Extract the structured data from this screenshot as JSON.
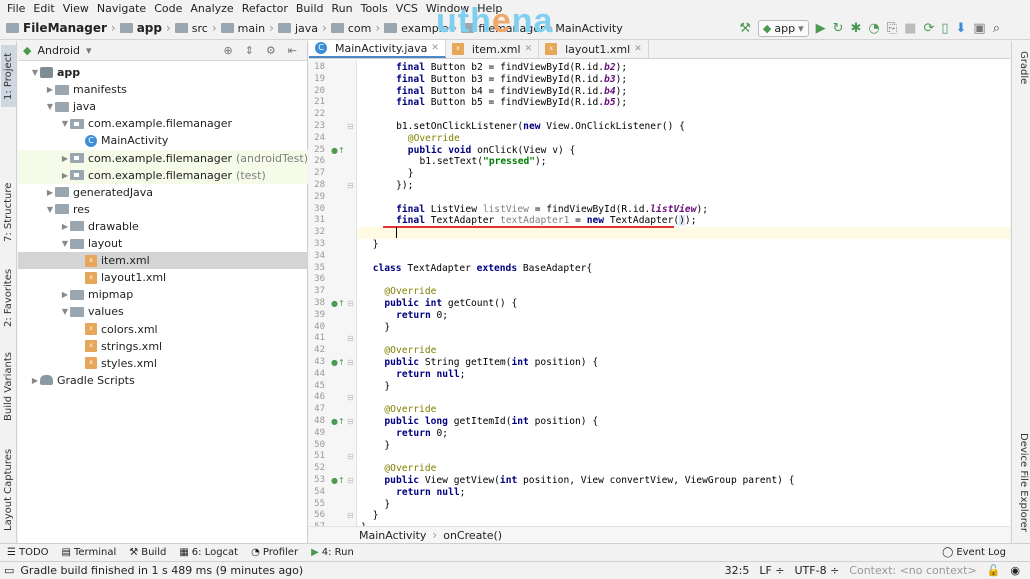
{
  "menubar": [
    "File",
    "Edit",
    "View",
    "Navigate",
    "Code",
    "Analyze",
    "Refactor",
    "Build",
    "Run",
    "Tools",
    "VCS",
    "Window",
    "Help"
  ],
  "watermark": {
    "left": "uth",
    "o": "e",
    "right": "na"
  },
  "breadcrumb": [
    "FileManager",
    "app",
    "src",
    "main",
    "java",
    "com",
    "example",
    "filemanager",
    "MainActivity"
  ],
  "toolbar": {
    "run_config": "app"
  },
  "left_tool_windows": [
    "1: Project",
    "7: Structure",
    "2: Favorites",
    "Build Variants",
    "Layout Captures"
  ],
  "right_tool_windows": [
    "Gradle",
    "Device File Explorer"
  ],
  "project": {
    "view": "Android",
    "tree": [
      {
        "label": "app",
        "bold": true
      },
      {
        "label": "manifests"
      },
      {
        "label": "java"
      },
      {
        "label": "com.example.filemanager"
      },
      {
        "label": "MainActivity"
      },
      {
        "label": "com.example.filemanager",
        "suffix": "(androidTest)"
      },
      {
        "label": "com.example.filemanager",
        "suffix": "(test)"
      },
      {
        "label": "generatedJava"
      },
      {
        "label": "res"
      },
      {
        "label": "drawable"
      },
      {
        "label": "layout"
      },
      {
        "label": "item.xml"
      },
      {
        "label": "layout1.xml"
      },
      {
        "label": "mipmap"
      },
      {
        "label": "values"
      },
      {
        "label": "colors.xml"
      },
      {
        "label": "strings.xml"
      },
      {
        "label": "styles.xml"
      },
      {
        "label": "Gradle Scripts"
      }
    ]
  },
  "editor": {
    "tabs": [
      "MainActivity.java",
      "item.xml",
      "layout1.xml"
    ],
    "lines": [
      "18",
      "19",
      "20",
      "21",
      "22",
      "23",
      "24",
      "25",
      "26",
      "27",
      "28",
      "29",
      "30",
      "31",
      "32",
      "33",
      "34",
      "35",
      "36",
      "37",
      "38",
      "39",
      "40",
      "41",
      "42",
      "43",
      "44",
      "45",
      "46",
      "47",
      "48",
      "49",
      "50",
      "51",
      "52",
      "53",
      "54",
      "55",
      "56",
      "57"
    ],
    "code": {
      "l18a": "final Button b2 = findViewById(R.id.",
      "l18b": "b2",
      "l18c": ");",
      "l19a": "final Button b3 = findViewById(R.id.",
      "l19b": "b3",
      "l19c": ");",
      "l20a": "final Button b4 = findViewById(R.id.",
      "l20b": "b4",
      "l20c": ");",
      "l21a": "final Button b5 = findViewById(R.id.",
      "l21b": "b5",
      "l21c": ");",
      "l23a": "b1.setOnClickListener(",
      "l23b": "new",
      "l23c": " View.OnClickListener() {",
      "override": "@Override",
      "l25a": "public void",
      "l25b": " onClick(View v) {",
      "l26a": "b1.setText(",
      "l26b": "\"pressed\"",
      "l26c": ");",
      "close1": "}",
      "close2": "});",
      "l30a": "final",
      "l30b": " ListView ",
      "l30c": "listView",
      "l30d": " = findViewById(R.id.",
      "l30e": "listView",
      "l30f": ");",
      "l31a": "final",
      "l31b": " TextAdapter ",
      "l31c": "textAdapter1",
      "l31d": " = ",
      "l31e": "new",
      "l31f": " TextAdapter(",
      "l31g": ")",
      "l31h": ");",
      "l33": "}",
      "l35a": "class",
      "l35b": " TextAdapter ",
      "l35c": "extends",
      "l35d": " BaseAdapter{",
      "l38a": "public int",
      "l38b": " getCount() {",
      "l39a": "return",
      "l39b": " 0;",
      "l43a": "public",
      "l43b": " String getItem(",
      "l43c": "int",
      "l43d": " position) {",
      "l44a": "return null",
      ";": ";",
      "l48a": "public long",
      "l48b": " getItemId(",
      "l48c": "int",
      "l48d": " position) {",
      "l53a": "public",
      "l53b": " View getView(",
      "l53c": "int",
      "l53d": " position, View convertView, ViewGroup parent) {",
      "l56": "}",
      "l57": "}"
    },
    "crumbs": [
      "MainActivity",
      "onCreate()"
    ]
  },
  "bottom_tabs": [
    "TODO",
    "Terminal",
    "Build",
    "6: Logcat",
    "Profiler",
    "4: Run"
  ],
  "event_log": "Event Log",
  "status": {
    "message": "Gradle build finished in 1 s 489 ms (9 minutes ago)",
    "position": "32:5",
    "line_sep": "LF",
    "encoding": "UTF-8",
    "context": "Context: <no context>"
  }
}
